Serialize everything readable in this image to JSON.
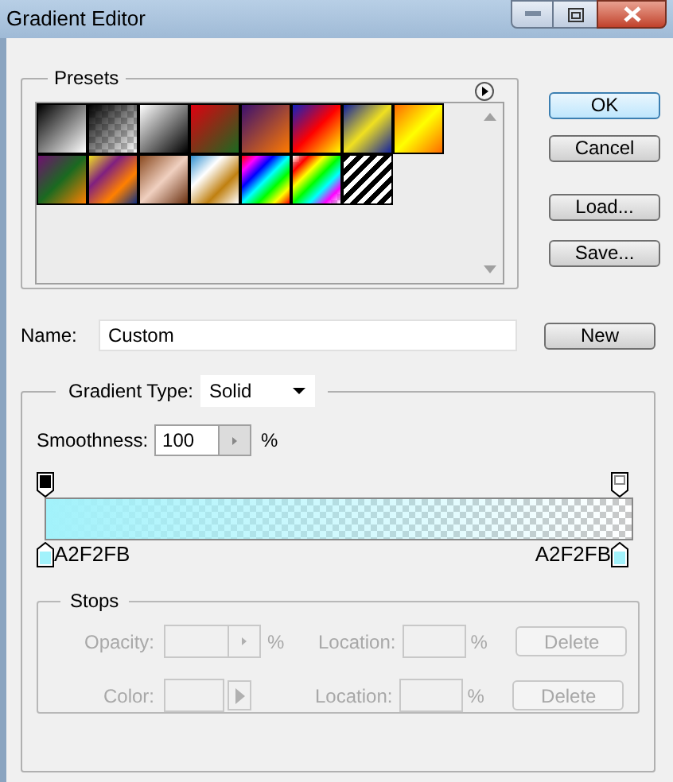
{
  "window": {
    "title": "Gradient Editor"
  },
  "presets": {
    "label": "Presets"
  },
  "buttons": [
    {
      "label": "OK",
      "default": true
    },
    {
      "label": "Cancel",
      "default": false
    },
    {
      "label": "Load...",
      "default": false
    },
    {
      "label": "Save...",
      "default": false
    }
  ],
  "name": {
    "label": "Name:",
    "value": "Custom",
    "button": "New"
  },
  "gradient": {
    "type_label": "Gradient Type:",
    "type_value": "Solid",
    "smoothness_label": "Smoothness:",
    "smoothness_value": "100",
    "smoothness_unit": "%",
    "opacity_stops": [
      {
        "opaque": true
      },
      {
        "opaque": false
      }
    ],
    "color_stops": [
      {
        "color": "#a2f2fb",
        "label": "A2F2FB"
      },
      {
        "color": "#a2f2fb",
        "label": "A2F2FB"
      }
    ]
  },
  "stops": {
    "label": "Stops",
    "disabled": true,
    "rows": [
      {
        "label": "Opacity:",
        "kind": "stepper",
        "unit": "%",
        "location_label": "Location:",
        "location_unit": "%",
        "button": "Delete"
      },
      {
        "label": "Color:",
        "kind": "swatch",
        "location_label": "Location:",
        "location_unit": "%",
        "button": "Delete"
      }
    ]
  }
}
